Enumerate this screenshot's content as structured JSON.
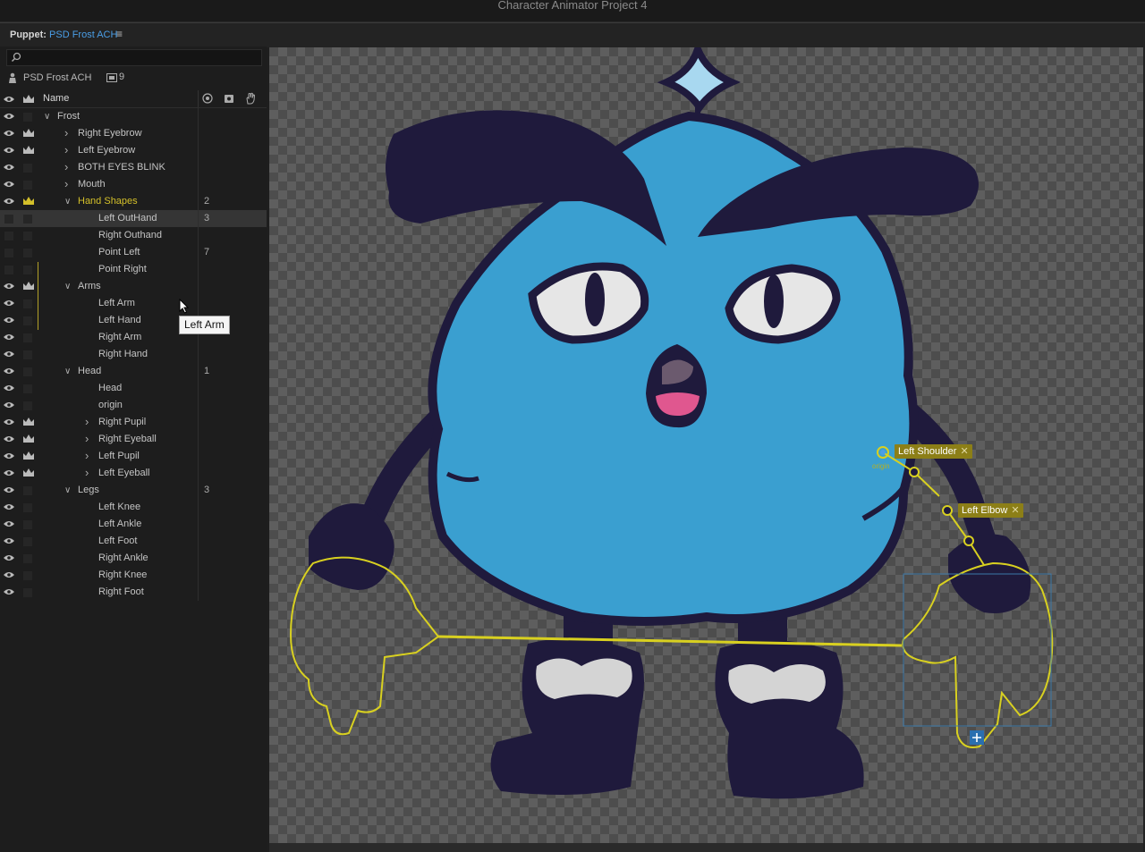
{
  "window": {
    "title": "Character Animator Project 4"
  },
  "panel": {
    "label": "Puppet:",
    "puppet_name": "PSD Frost ACH"
  },
  "search": {
    "placeholder": ""
  },
  "puppet_row": {
    "name": "PSD Frost ACH",
    "count": "9"
  },
  "columns": {
    "name": "Name"
  },
  "layers": [
    {
      "label": "Frost",
      "indent": 0,
      "chevron": "down",
      "crown": false,
      "eye": true,
      "count": ""
    },
    {
      "label": "Right Eyebrow",
      "indent": 1,
      "chevron": "right",
      "crown": true,
      "eye": true,
      "count": ""
    },
    {
      "label": "Left Eyebrow",
      "indent": 1,
      "chevron": "right",
      "crown": true,
      "eye": true,
      "count": ""
    },
    {
      "label": "BOTH EYES BLINK",
      "indent": 1,
      "chevron": "right",
      "crown": false,
      "eye": true,
      "count": ""
    },
    {
      "label": "Mouth",
      "indent": 1,
      "chevron": "right",
      "crown": false,
      "eye": true,
      "count": ""
    },
    {
      "label": "Hand Shapes",
      "indent": 1,
      "chevron": "down",
      "crown": true,
      "eye": true,
      "count": "2",
      "highlight": true
    },
    {
      "label": "Left OutHand",
      "indent": 2,
      "chevron": "",
      "crown": false,
      "eye": false,
      "count": "3",
      "selected": true
    },
    {
      "label": "Right Outhand",
      "indent": 2,
      "chevron": "",
      "crown": false,
      "eye": false,
      "count": ""
    },
    {
      "label": "Point Left",
      "indent": 2,
      "chevron": "",
      "crown": false,
      "eye": false,
      "count": "7"
    },
    {
      "label": "Point Right",
      "indent": 2,
      "chevron": "",
      "crown": false,
      "eye": false,
      "count": ""
    },
    {
      "label": "Arms",
      "indent": 1,
      "chevron": "down",
      "crown": true,
      "eye": true,
      "count": ""
    },
    {
      "label": "Left Arm",
      "indent": 2,
      "chevron": "",
      "crown": false,
      "eye": true,
      "count": ""
    },
    {
      "label": "Left Hand",
      "indent": 2,
      "chevron": "",
      "crown": false,
      "eye": true,
      "count": ""
    },
    {
      "label": "Right Arm",
      "indent": 2,
      "chevron": "",
      "crown": false,
      "eye": true,
      "count": ""
    },
    {
      "label": "Right Hand",
      "indent": 2,
      "chevron": "",
      "crown": false,
      "eye": true,
      "count": ""
    },
    {
      "label": "Head",
      "indent": 1,
      "chevron": "down",
      "crown": false,
      "eye": true,
      "count": "1"
    },
    {
      "label": "Head",
      "indent": 2,
      "chevron": "",
      "crown": false,
      "eye": true,
      "count": ""
    },
    {
      "label": "origin",
      "indent": 2,
      "chevron": "",
      "crown": false,
      "eye": true,
      "count": ""
    },
    {
      "label": "Right Pupil",
      "indent": 2,
      "chevron": "right",
      "crown": true,
      "eye": true,
      "count": ""
    },
    {
      "label": "Right Eyeball",
      "indent": 2,
      "chevron": "right",
      "crown": true,
      "eye": true,
      "count": ""
    },
    {
      "label": "Left Pupil",
      "indent": 2,
      "chevron": "right",
      "crown": true,
      "eye": true,
      "count": ""
    },
    {
      "label": "Left Eyeball",
      "indent": 2,
      "chevron": "right",
      "crown": true,
      "eye": true,
      "count": ""
    },
    {
      "label": "Legs",
      "indent": 1,
      "chevron": "down",
      "crown": false,
      "eye": true,
      "count": "3"
    },
    {
      "label": "Left Knee",
      "indent": 2,
      "chevron": "",
      "crown": false,
      "eye": true,
      "count": ""
    },
    {
      "label": "Left Ankle",
      "indent": 2,
      "chevron": "",
      "crown": false,
      "eye": true,
      "count": ""
    },
    {
      "label": "Left Foot",
      "indent": 2,
      "chevron": "",
      "crown": false,
      "eye": true,
      "count": ""
    },
    {
      "label": "Right Ankle",
      "indent": 2,
      "chevron": "",
      "crown": false,
      "eye": true,
      "count": ""
    },
    {
      "label": "Right Knee",
      "indent": 2,
      "chevron": "",
      "crown": false,
      "eye": true,
      "count": ""
    },
    {
      "label": "Right Foot",
      "indent": 2,
      "chevron": "",
      "crown": false,
      "eye": true,
      "count": ""
    }
  ],
  "tooltip": {
    "text": "Left Arm"
  },
  "canvas": {
    "tags": {
      "shoulder": "Left Shoulder",
      "elbow": "Left Elbow",
      "origin": "origin"
    }
  },
  "colors": {
    "accent": "#4a9ee6",
    "handle": "#d8d020",
    "body": "#3a9fd0",
    "outline": "#1f1a3c",
    "mouth": "#e0578f"
  },
  "icons": [
    "search-icon",
    "puppet-icon",
    "layers-icon",
    "eye-icon",
    "crown-icon",
    "origin-icon",
    "tracking-icon",
    "handle-icon",
    "chevron-down-icon",
    "chevron-right-icon",
    "menu-icon",
    "cursor-icon",
    "close-icon",
    "plus-icon"
  ]
}
